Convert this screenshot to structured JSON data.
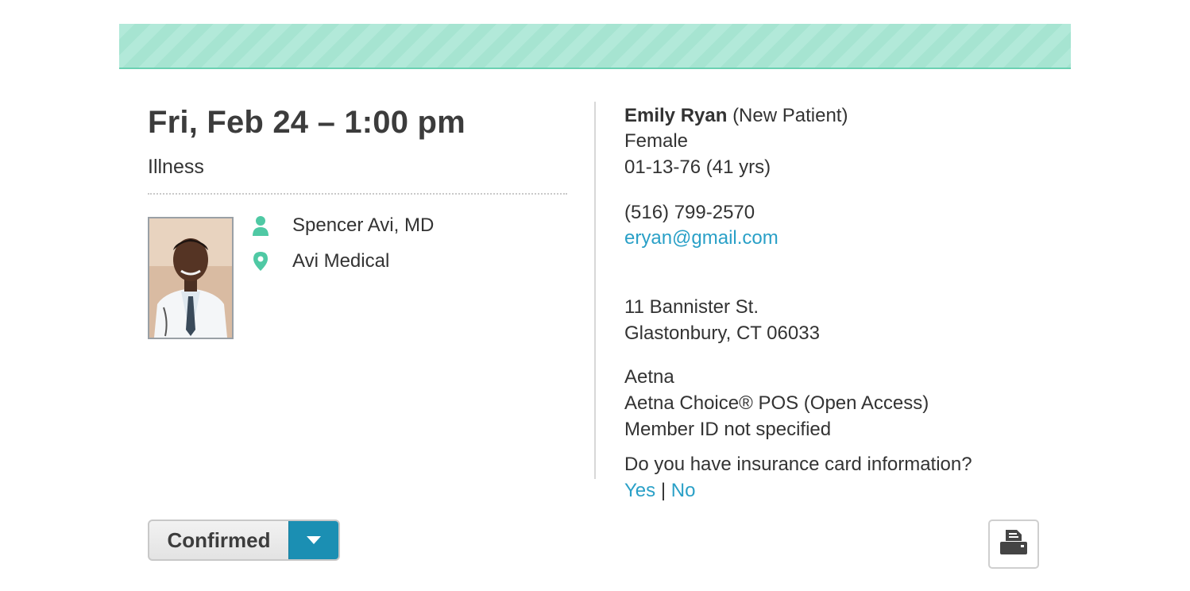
{
  "appointment": {
    "datetime": "Fri, Feb 24 – 1:00 pm",
    "reason": "Illness"
  },
  "provider": {
    "name": "Spencer Avi, MD",
    "practice": "Avi Medical",
    "person_icon": "person-icon",
    "location_icon": "location-pin-icon"
  },
  "patient": {
    "name": "Emily Ryan",
    "status": "(New Patient)",
    "gender": "Female",
    "dob": "01-13-76 (41 yrs)",
    "phone": "(516) 799-2570",
    "email": "eryan@gmail.com",
    "address_line1": "11 Bannister St.",
    "address_line2": "Glastonbury, CT 06033",
    "insurance_carrier": "Aetna",
    "insurance_plan": "Aetna Choice® POS (Open Access)",
    "member_id": "Member ID not specified",
    "card_question": "Do you have insurance card information?",
    "yes_label": "Yes",
    "separator": "|",
    "no_label": "No"
  },
  "actions": {
    "status_label": "Confirmed",
    "status_dropdown_icon": "chevron-down-icon",
    "print_icon": "print-icon"
  },
  "colors": {
    "accent_teal": "#4fc9a4",
    "link_blue": "#2aa0c7",
    "button_blue": "#1b8fb3",
    "banner_stripe": "#b2e9d9"
  }
}
